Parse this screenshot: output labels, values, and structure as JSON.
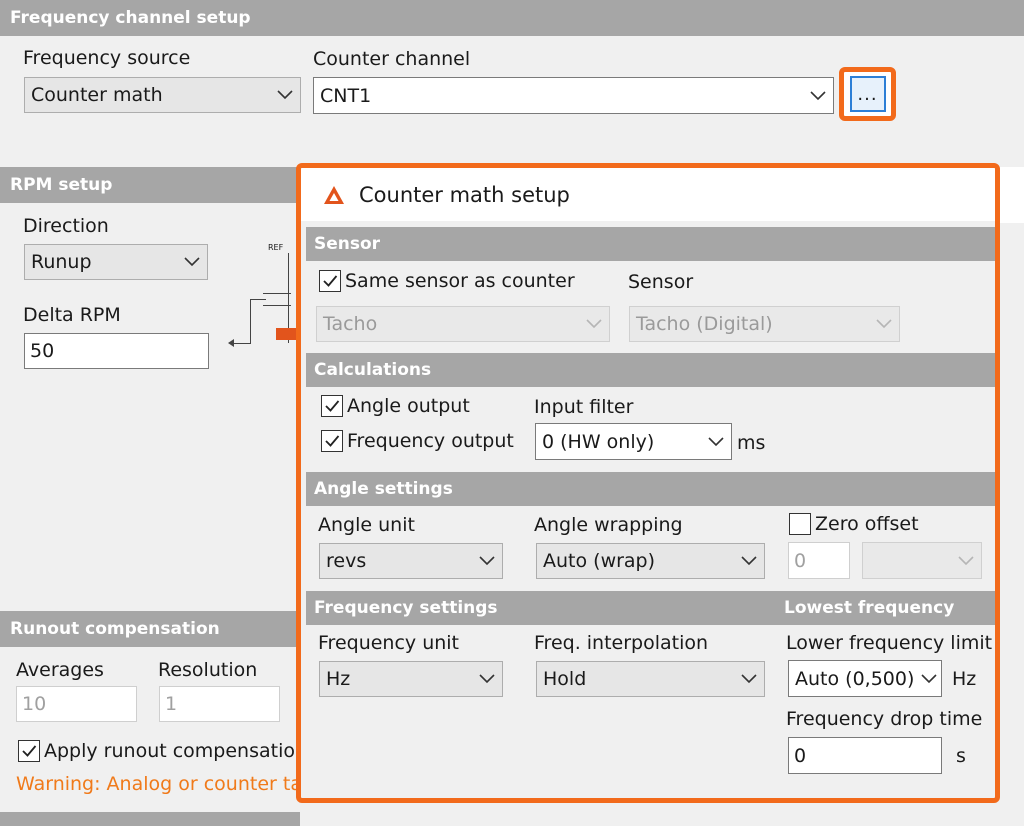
{
  "frequency_channel_setup": {
    "header": "Frequency channel setup",
    "frequency_source_label": "Frequency source",
    "frequency_source_value": "Counter math",
    "counter_channel_label": "Counter channel",
    "counter_channel_value": "CNT1",
    "browse_button": "..."
  },
  "rpm_setup": {
    "header": "RPM setup",
    "direction_label": "Direction",
    "direction_value": "Runup",
    "delta_rpm_label": "Delta RPM",
    "delta_rpm_value": "50",
    "diagram_ref_label": "REF"
  },
  "runout_compensation": {
    "header": "Runout compensation",
    "averages_label": "Averages",
    "averages_value": "10",
    "resolution_label": "Resolution",
    "resolution_value": "1",
    "apply_label": "Apply runout compensation",
    "apply_checked": true,
    "warning": "Warning: Analog or counter tac"
  },
  "dialog": {
    "title": "Counter math setup",
    "sensor": {
      "header": "Sensor",
      "same_sensor_label": "Same sensor as counter",
      "same_sensor_checked": true,
      "sensor_type_value": "Tacho",
      "sensor_label": "Sensor",
      "sensor_value": "Tacho (Digital)"
    },
    "calculations": {
      "header": "Calculations",
      "angle_output_label": "Angle output",
      "angle_output_checked": true,
      "frequency_output_label": "Frequency output",
      "frequency_output_checked": true,
      "input_filter_label": "Input filter",
      "input_filter_value": "0 (HW only)",
      "input_filter_unit": "ms"
    },
    "angle_settings": {
      "header": "Angle settings",
      "angle_unit_label": "Angle unit",
      "angle_unit_value": "revs",
      "angle_wrapping_label": "Angle wrapping",
      "angle_wrapping_value": "Auto (wrap)",
      "zero_offset_label": "Zero offset",
      "zero_offset_checked": false,
      "zero_offset_value": "0"
    },
    "frequency_settings": {
      "header": "Frequency settings",
      "frequency_unit_label": "Frequency unit",
      "frequency_unit_value": "Hz",
      "freq_interpolation_label": "Freq. interpolation",
      "freq_interpolation_value": "Hold"
    },
    "lowest_frequency": {
      "header": "Lowest frequency",
      "lower_limit_label": "Lower frequency limit",
      "lower_limit_value": "Auto (0,500)",
      "lower_limit_unit": "Hz",
      "drop_time_label": "Frequency drop time",
      "drop_time_value": "0",
      "drop_time_unit": "s"
    }
  },
  "colors": {
    "highlight": "#f26a1b",
    "section_header": "#a6a6a6",
    "warning": "#f07a1a",
    "focus_blue": "#2d7fd6"
  }
}
